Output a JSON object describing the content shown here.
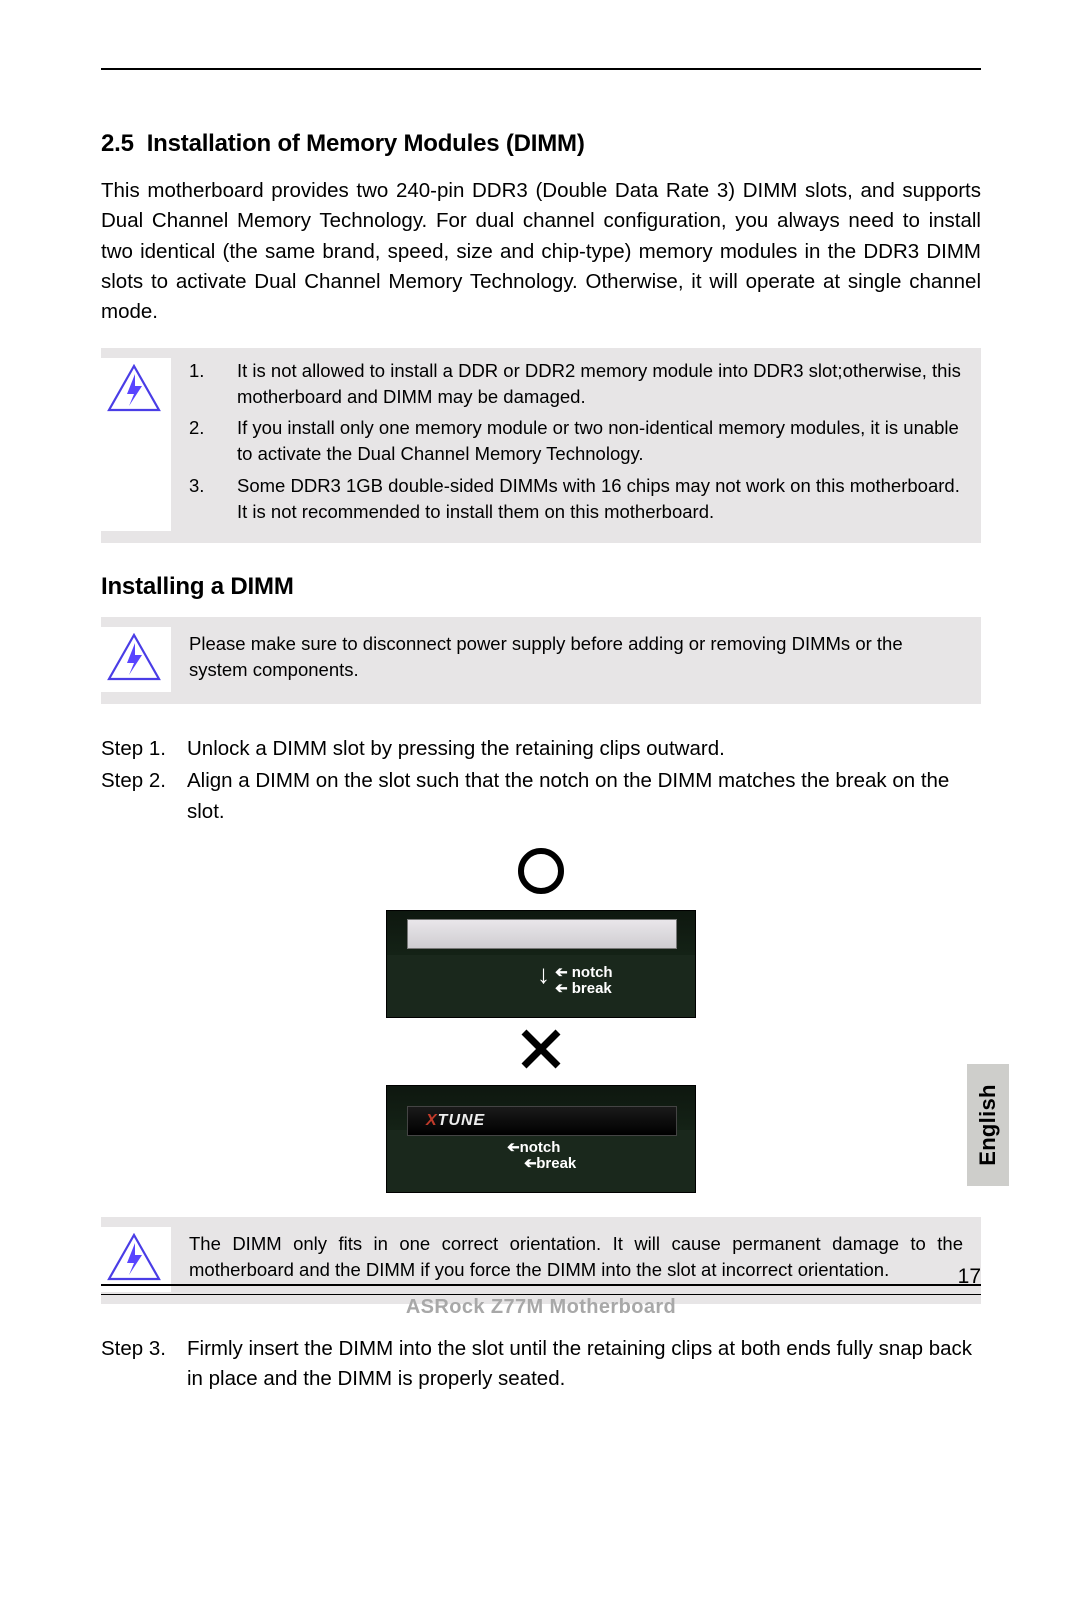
{
  "section": {
    "number": "2.5",
    "title": "Installation of Memory Modules (DIMM)",
    "intro": "This motherboard provides two 240-pin DDR3 (Double Data Rate 3) DIMM slots, and supports Dual Channel Memory Technology. For dual channel configuration, you always need to install two identical (the same brand, speed, size and chip-type) memory modules in the DDR3 DIMM slots to activate Dual Channel Memory Technology. Otherwise, it will operate at single channel mode."
  },
  "warning1": {
    "items": [
      "It is not allowed to install a DDR or DDR2 memory module into DDR3 slot;otherwise, this motherboard and DIMM may be damaged.",
      "If you install only one memory module or two non-identical memory modules, it is unable to activate the Dual Channel Memory Technology.",
      "Some DDR3 1GB double-sided DIMMs with 16 chips may not work on this motherboard. It is not recommended to install them on this motherboard."
    ]
  },
  "subheading": "Installing a DIMM",
  "warning2": {
    "text": "Please make sure to disconnect power supply before adding or removing DIMMs or the system components."
  },
  "steps12": [
    {
      "label": "Step 1.",
      "text": "Unlock a DIMM slot by pressing the retaining clips outward."
    },
    {
      "label": "Step 2.",
      "text": "Align a DIMM on the slot such that the notch on the DIMM matches the break on the slot."
    }
  ],
  "diagram": {
    "notch": "notch",
    "break": "break",
    "xtune": "XTUNE"
  },
  "warning3": {
    "text": "The DIMM only fits in one correct orientation. It will cause permanent damage to the motherboard and the DIMM if you force the DIMM into the slot at incorrect orientation."
  },
  "step3": {
    "label": "Step 3.",
    "text": "Firmly insert the DIMM into the slot until the retaining clips at both ends fully snap back in place and the DIMM is properly seated."
  },
  "footer": {
    "product": "ASRock  Z77M  Motherboard",
    "page": "17",
    "language": "English"
  }
}
